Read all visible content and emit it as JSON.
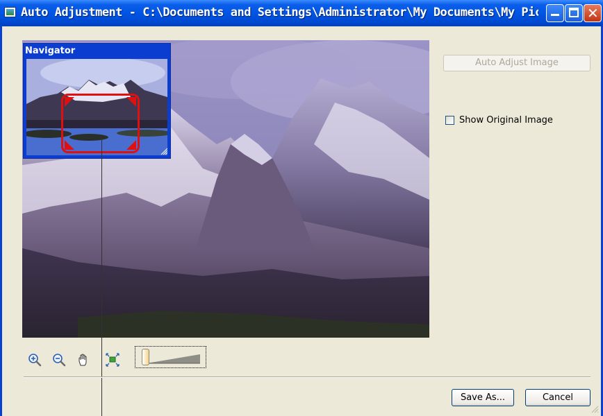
{
  "window": {
    "title": "Auto Adjustment - C:\\Documents and Settings\\Administrator\\My Documents\\My Pictures...",
    "controls": [
      "minimize",
      "maximize",
      "close"
    ],
    "close_glyph": "✕"
  },
  "navigator": {
    "title": "Navigator"
  },
  "right_panel": {
    "auto_adjust_label": "Auto Adjust Image",
    "show_original_label": "Show Original Image",
    "show_original_checked": false
  },
  "toolbar": {
    "icons": [
      "zoom-in-icon",
      "zoom-out-icon",
      "hand-pan-icon",
      "fit-to-window-icon"
    ],
    "zoom_slider_level": 0
  },
  "footer": {
    "save_as_label": "Save As...",
    "cancel_label": "Cancel"
  },
  "colors": {
    "titlebar": "#0055e5",
    "window_bg": "#ece9d8",
    "navigator_frame": "#e01010"
  }
}
